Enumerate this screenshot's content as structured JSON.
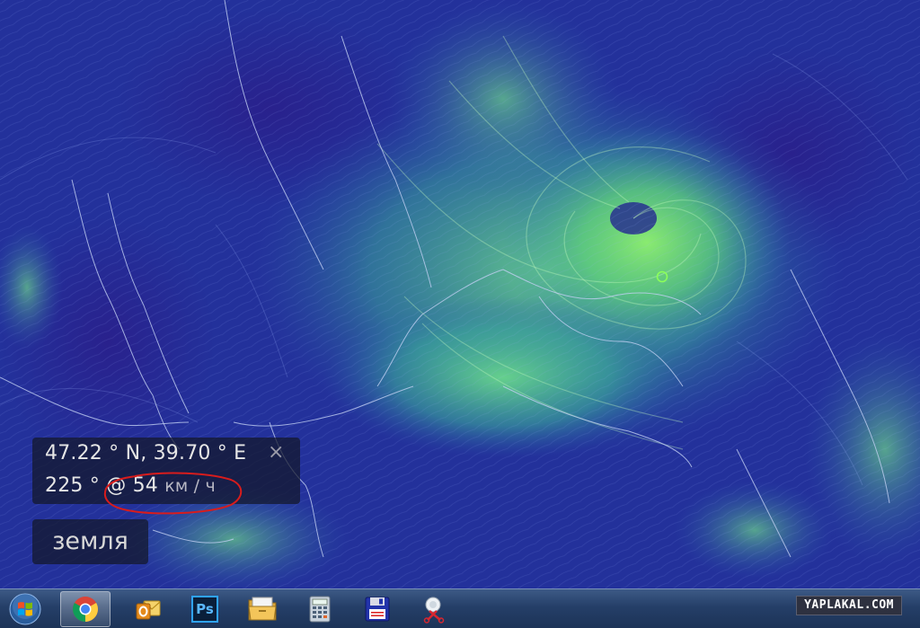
{
  "overlay": {
    "coordinates": "47.22 ° N, 39.70 ° E",
    "close_symbol": "×",
    "wind_direction": "225 °",
    "wind_speed_prefix": "@ 54",
    "wind_speed_unit": "км / ч",
    "annotation_color": "#d81c1c"
  },
  "menu_button": {
    "label": "земля"
  },
  "taskbar": {
    "items": [
      {
        "name": "windows-start",
        "active": false
      },
      {
        "name": "chrome-icon",
        "active": true
      },
      {
        "name": "outlook-icon",
        "active": false
      },
      {
        "name": "photoshop-icon",
        "active": false,
        "label": "Ps"
      },
      {
        "name": "file-explorer-icon",
        "active": false
      },
      {
        "name": "calculator-icon",
        "active": false
      },
      {
        "name": "save-floppy-icon",
        "active": false
      },
      {
        "name": "snipping-tool-icon",
        "active": false
      }
    ]
  },
  "watermark": {
    "text": "YAPLAKAL.COM"
  },
  "colors": {
    "map_background": "#1c2a94",
    "wind_fast": "#7cf07a",
    "wind_medium": "#3fa6a0",
    "coastline": "#b9c8ee"
  }
}
